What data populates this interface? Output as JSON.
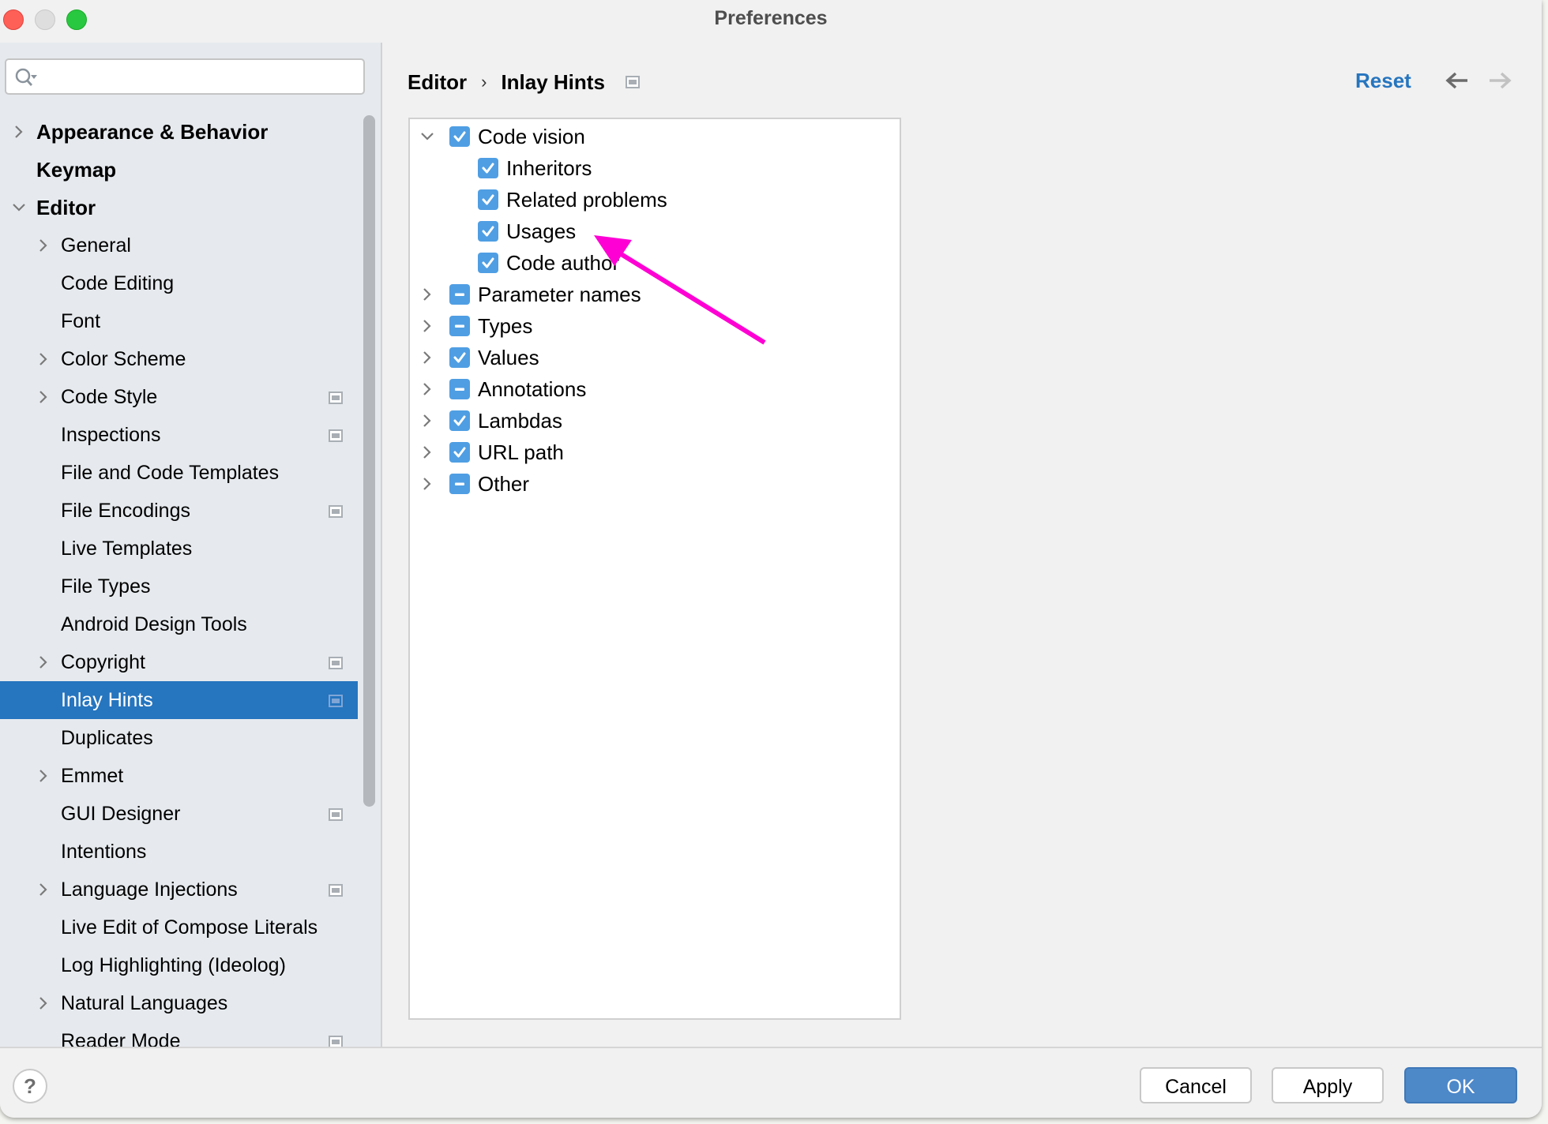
{
  "window": {
    "title": "Preferences"
  },
  "sidebar": {
    "search": {
      "value": "",
      "placeholder": ""
    },
    "items": [
      {
        "label": "Appearance & Behavior",
        "level": 0,
        "bold": true,
        "expander": "collapsed",
        "project_icon": false,
        "selected": false
      },
      {
        "label": "Keymap",
        "level": 0,
        "bold": true,
        "expander": "none",
        "project_icon": false,
        "selected": false
      },
      {
        "label": "Editor",
        "level": 0,
        "bold": true,
        "expander": "expanded",
        "project_icon": false,
        "selected": false
      },
      {
        "label": "General",
        "level": 1,
        "bold": false,
        "expander": "collapsed",
        "project_icon": false,
        "selected": false
      },
      {
        "label": "Code Editing",
        "level": 1,
        "bold": false,
        "expander": "none",
        "project_icon": false,
        "selected": false
      },
      {
        "label": "Font",
        "level": 1,
        "bold": false,
        "expander": "none",
        "project_icon": false,
        "selected": false
      },
      {
        "label": "Color Scheme",
        "level": 1,
        "bold": false,
        "expander": "collapsed",
        "project_icon": false,
        "selected": false
      },
      {
        "label": "Code Style",
        "level": 1,
        "bold": false,
        "expander": "collapsed",
        "project_icon": true,
        "selected": false
      },
      {
        "label": "Inspections",
        "level": 1,
        "bold": false,
        "expander": "none",
        "project_icon": true,
        "selected": false
      },
      {
        "label": "File and Code Templates",
        "level": 1,
        "bold": false,
        "expander": "none",
        "project_icon": false,
        "selected": false
      },
      {
        "label": "File Encodings",
        "level": 1,
        "bold": false,
        "expander": "none",
        "project_icon": true,
        "selected": false
      },
      {
        "label": "Live Templates",
        "level": 1,
        "bold": false,
        "expander": "none",
        "project_icon": false,
        "selected": false
      },
      {
        "label": "File Types",
        "level": 1,
        "bold": false,
        "expander": "none",
        "project_icon": false,
        "selected": false
      },
      {
        "label": "Android Design Tools",
        "level": 1,
        "bold": false,
        "expander": "none",
        "project_icon": false,
        "selected": false
      },
      {
        "label": "Copyright",
        "level": 1,
        "bold": false,
        "expander": "collapsed",
        "project_icon": true,
        "selected": false
      },
      {
        "label": "Inlay Hints",
        "level": 1,
        "bold": false,
        "expander": "none",
        "project_icon": true,
        "selected": true
      },
      {
        "label": "Duplicates",
        "level": 1,
        "bold": false,
        "expander": "none",
        "project_icon": false,
        "selected": false
      },
      {
        "label": "Emmet",
        "level": 1,
        "bold": false,
        "expander": "collapsed",
        "project_icon": false,
        "selected": false
      },
      {
        "label": "GUI Designer",
        "level": 1,
        "bold": false,
        "expander": "none",
        "project_icon": true,
        "selected": false
      },
      {
        "label": "Intentions",
        "level": 1,
        "bold": false,
        "expander": "none",
        "project_icon": false,
        "selected": false
      },
      {
        "label": "Language Injections",
        "level": 1,
        "bold": false,
        "expander": "collapsed",
        "project_icon": true,
        "selected": false
      },
      {
        "label": "Live Edit of Compose Literals",
        "level": 1,
        "bold": false,
        "expander": "none",
        "project_icon": false,
        "selected": false
      },
      {
        "label": "Log Highlighting (Ideolog)",
        "level": 1,
        "bold": false,
        "expander": "none",
        "project_icon": false,
        "selected": false
      },
      {
        "label": "Natural Languages",
        "level": 1,
        "bold": false,
        "expander": "collapsed",
        "project_icon": false,
        "selected": false
      },
      {
        "label": "Reader Mode",
        "level": 1,
        "bold": false,
        "expander": "none",
        "project_icon": true,
        "selected": false
      }
    ]
  },
  "header": {
    "breadcrumb": [
      "Editor",
      "Inlay Hints"
    ],
    "breadcrumb_separator": "›",
    "reset_label": "Reset",
    "back_icon": "arrow-left-icon",
    "forward_icon": "arrow-right-icon",
    "forward_enabled": false
  },
  "hints_tree": [
    {
      "label": "Code vision",
      "level": 0,
      "expander": "expanded",
      "state": "checked"
    },
    {
      "label": "Inheritors",
      "level": 1,
      "expander": "none",
      "state": "checked"
    },
    {
      "label": "Related problems",
      "level": 1,
      "expander": "none",
      "state": "checked"
    },
    {
      "label": "Usages",
      "level": 1,
      "expander": "none",
      "state": "checked"
    },
    {
      "label": "Code author",
      "level": 1,
      "expander": "none",
      "state": "checked"
    },
    {
      "label": "Parameter names",
      "level": 0,
      "expander": "collapsed",
      "state": "partial"
    },
    {
      "label": "Types",
      "level": 0,
      "expander": "collapsed",
      "state": "partial"
    },
    {
      "label": "Values",
      "level": 0,
      "expander": "collapsed",
      "state": "checked"
    },
    {
      "label": "Annotations",
      "level": 0,
      "expander": "collapsed",
      "state": "partial"
    },
    {
      "label": "Lambdas",
      "level": 0,
      "expander": "collapsed",
      "state": "checked"
    },
    {
      "label": "URL path",
      "level": 0,
      "expander": "collapsed",
      "state": "checked"
    },
    {
      "label": "Other",
      "level": 0,
      "expander": "collapsed",
      "state": "partial"
    }
  ],
  "annotation": {
    "type": "arrow",
    "color": "#ff00d4",
    "points_to": "Usages"
  },
  "footer": {
    "help_label": "?",
    "cancel_label": "Cancel",
    "apply_label": "Apply",
    "ok_label": "OK"
  },
  "colors": {
    "accent": "#2675bf",
    "checkbox": "#4f9ee3",
    "ok_button": "#4d88c9",
    "sidebar_bg": "#e6eaee",
    "annotation_arrow": "#ff00d4"
  }
}
